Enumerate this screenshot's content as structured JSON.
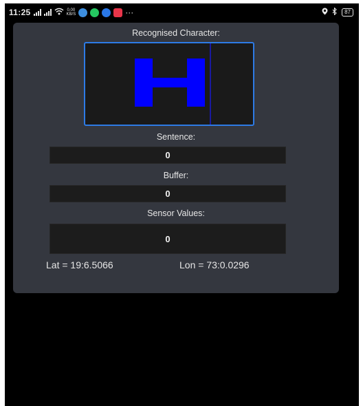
{
  "statusbar": {
    "time": "11:25",
    "speed_value": "0.00",
    "speed_unit": "KB/S",
    "more": "···",
    "battery": "87"
  },
  "app": {
    "recognised_label": "Recognised Character:",
    "recognised_char": "H",
    "sentence_label": "Sentence:",
    "sentence_value": "0",
    "buffer_label": "Buffer:",
    "buffer_value": "0",
    "sensor_label": "Sensor Values:",
    "sensor_value": "0",
    "lat": "Lat = 19:6.5066",
    "lon": "Lon = 73:0.0296"
  },
  "colors": {
    "card": "#34373f",
    "canvas_border": "#2d7be6",
    "glyph": "#0000ff"
  }
}
